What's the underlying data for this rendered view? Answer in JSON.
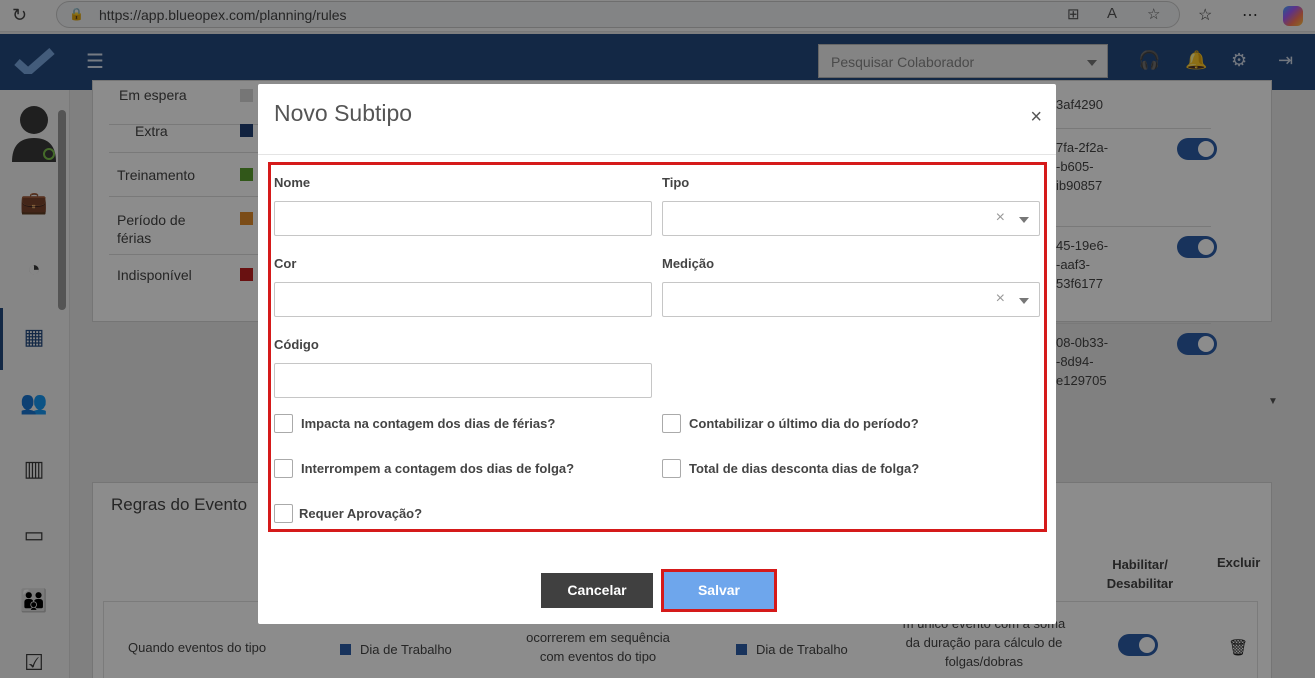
{
  "browser": {
    "url": "https://app.blueopex.com/planning/rules"
  },
  "topnav": {
    "search_placeholder": "Pesquisar Colaborador"
  },
  "background": {
    "legend": [
      {
        "label": "Em espera",
        "color": "#d8d8d8"
      },
      {
        "label": "Extra",
        "color": "#1f3f73"
      },
      {
        "label": "Treinamento",
        "color": "#5a9e2f"
      },
      {
        "label": "Período de férias",
        "color": "#e08a2a"
      },
      {
        "label": "Indisponível",
        "color": "#c0201f"
      }
    ],
    "ids": [
      {
        "lines": [
          "3af4290"
        ]
      },
      {
        "lines": [
          "7fa-2f2a-",
          "-b605-",
          "ib90857"
        ]
      },
      {
        "lines": [
          "45-19e6-",
          "-aaf3-",
          "53f6177"
        ]
      },
      {
        "lines": [
          "08-0b33-",
          "-8d94-",
          "e129705"
        ]
      }
    ],
    "rules_panel_title": "Regras do Evento",
    "col_headers": {
      "enable": "Habilitar/ Desabilitar",
      "delete": "Excluir"
    },
    "rule_row": {
      "when": "Quando eventos do tipo",
      "type1": "Dia de Trabalho",
      "sequence": "ocorrerem em sequência com eventos do tipo",
      "type2": "Dia de Trabalho",
      "result": "m único evento com a soma da duração para cálculo de folgas/dobras"
    }
  },
  "modal": {
    "title": "Novo Subtipo",
    "close": "×",
    "fields": {
      "nome": {
        "label": "Nome",
        "value": ""
      },
      "tipo": {
        "label": "Tipo",
        "value": ""
      },
      "cor": {
        "label": "Cor",
        "value": ""
      },
      "medicao": {
        "label": "Medição",
        "value": ""
      },
      "codigo": {
        "label": "Código",
        "value": ""
      }
    },
    "clear_symbol": "×",
    "checkboxes": {
      "impacta": "Impacta na contagem dos dias de férias?",
      "contabilizar": "Contabilizar o último dia do período?",
      "interrompem": "Interrompem a contagem dos dias de folga?",
      "total": "Total de dias desconta dias de folga?",
      "requer": "Requer Aprovação?"
    },
    "buttons": {
      "cancel": "Cancelar",
      "save": "Salvar"
    }
  },
  "colors": {
    "nav": "#244a7f",
    "highlight": "#d51a1a",
    "save": "#6ea6ec",
    "cancel": "#404040"
  }
}
